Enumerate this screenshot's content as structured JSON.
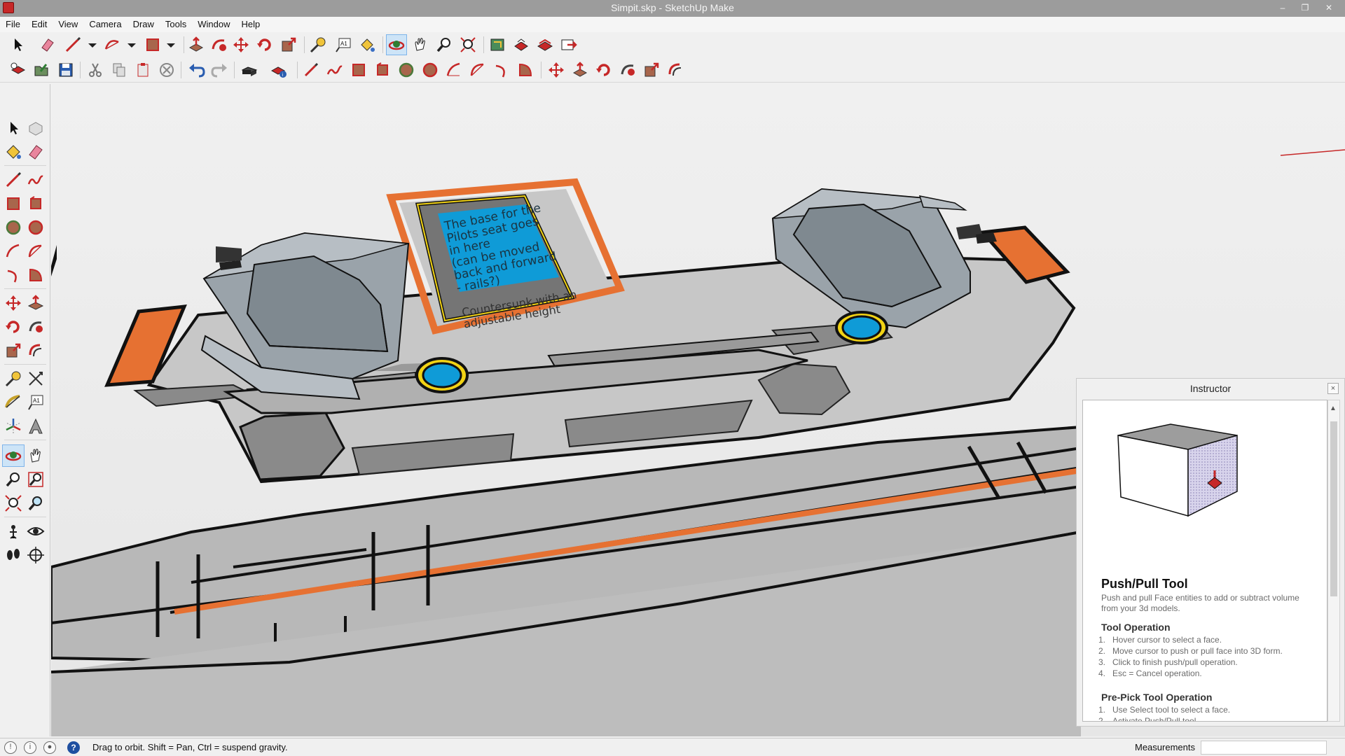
{
  "window": {
    "title": "Simpit.skp - SketchUp Make",
    "minimize": "–",
    "restore": "❐",
    "close": "✕"
  },
  "menu": [
    "File",
    "Edit",
    "View",
    "Camera",
    "Draw",
    "Tools",
    "Window",
    "Help"
  ],
  "toolbar_row1_icons": [
    "select-icon",
    "eraser-icon",
    "line-icon",
    "arc-icon",
    "rectangle-icon",
    "push-pull-icon",
    "follow-me-icon",
    "move-icon",
    "rotate-icon",
    "scale-icon",
    "tape-measure-icon",
    "text-icon",
    "paint-bucket-icon",
    "orbit-icon",
    "pan-icon",
    "zoom-icon",
    "zoom-extents-icon",
    "3d-warehouse-icon",
    "extension-warehouse-icon",
    "layout-icon",
    "send-to-layout-icon"
  ],
  "toolbar_row2_icons": [
    "new-icon",
    "open-icon",
    "save-icon",
    "cut-icon",
    "copy-icon",
    "paste-icon",
    "delete-icon",
    "undo-icon",
    "redo-icon",
    "print-icon",
    "model-info-icon",
    "pencil-icon",
    "freehand-icon",
    "rectangle-icon",
    "rotated-rectangle-icon",
    "circle-icon",
    "polygon-icon",
    "arc-icon",
    "two-point-arc-icon",
    "three-point-arc-icon",
    "pie-icon",
    "move-icon",
    "push-pull-icon",
    "rotate-icon",
    "follow-me-icon",
    "scale-icon",
    "offset-icon"
  ],
  "scene_notes": {
    "main": "The base for the\nPilots seat goes\nin here\n(can be moved\nback and forward\n- rails?)",
    "sub": "Countersunk with an\nadjustable height"
  },
  "instructor": {
    "header": "Instructor",
    "close": "×",
    "title": "Push/Pull Tool",
    "description": "Push and pull Face entities to add or subtract volume from your 3d models.",
    "section1": "Tool Operation",
    "steps1": [
      {
        "n": "1.",
        "text": "Hover cursor to select a face."
      },
      {
        "n": "2.",
        "text": "Move cursor to push or pull face into 3D form."
      },
      {
        "n": "3.",
        "text": "Click to finish push/pull operation."
      },
      {
        "n": "4.",
        "text": "Esc = Cancel operation."
      }
    ],
    "section2": "Pre-Pick Tool Operation",
    "steps2": [
      {
        "n": "1.",
        "text": "Use Select tool to select a face."
      },
      {
        "n": "2.",
        "text": "Activate Push/Pull tool."
      }
    ]
  },
  "status": {
    "hint": "Drag to orbit. Shift = Pan, Ctrl = suspend gravity.",
    "measurements_label": "Measurements",
    "measurements_value": "",
    "help": "?"
  },
  "colors": {
    "accent_orange": "#e67132",
    "accent_blue": "#0f9bd7",
    "panel_gray": "#b3b3b3",
    "seat_gray": "#8e989f"
  }
}
